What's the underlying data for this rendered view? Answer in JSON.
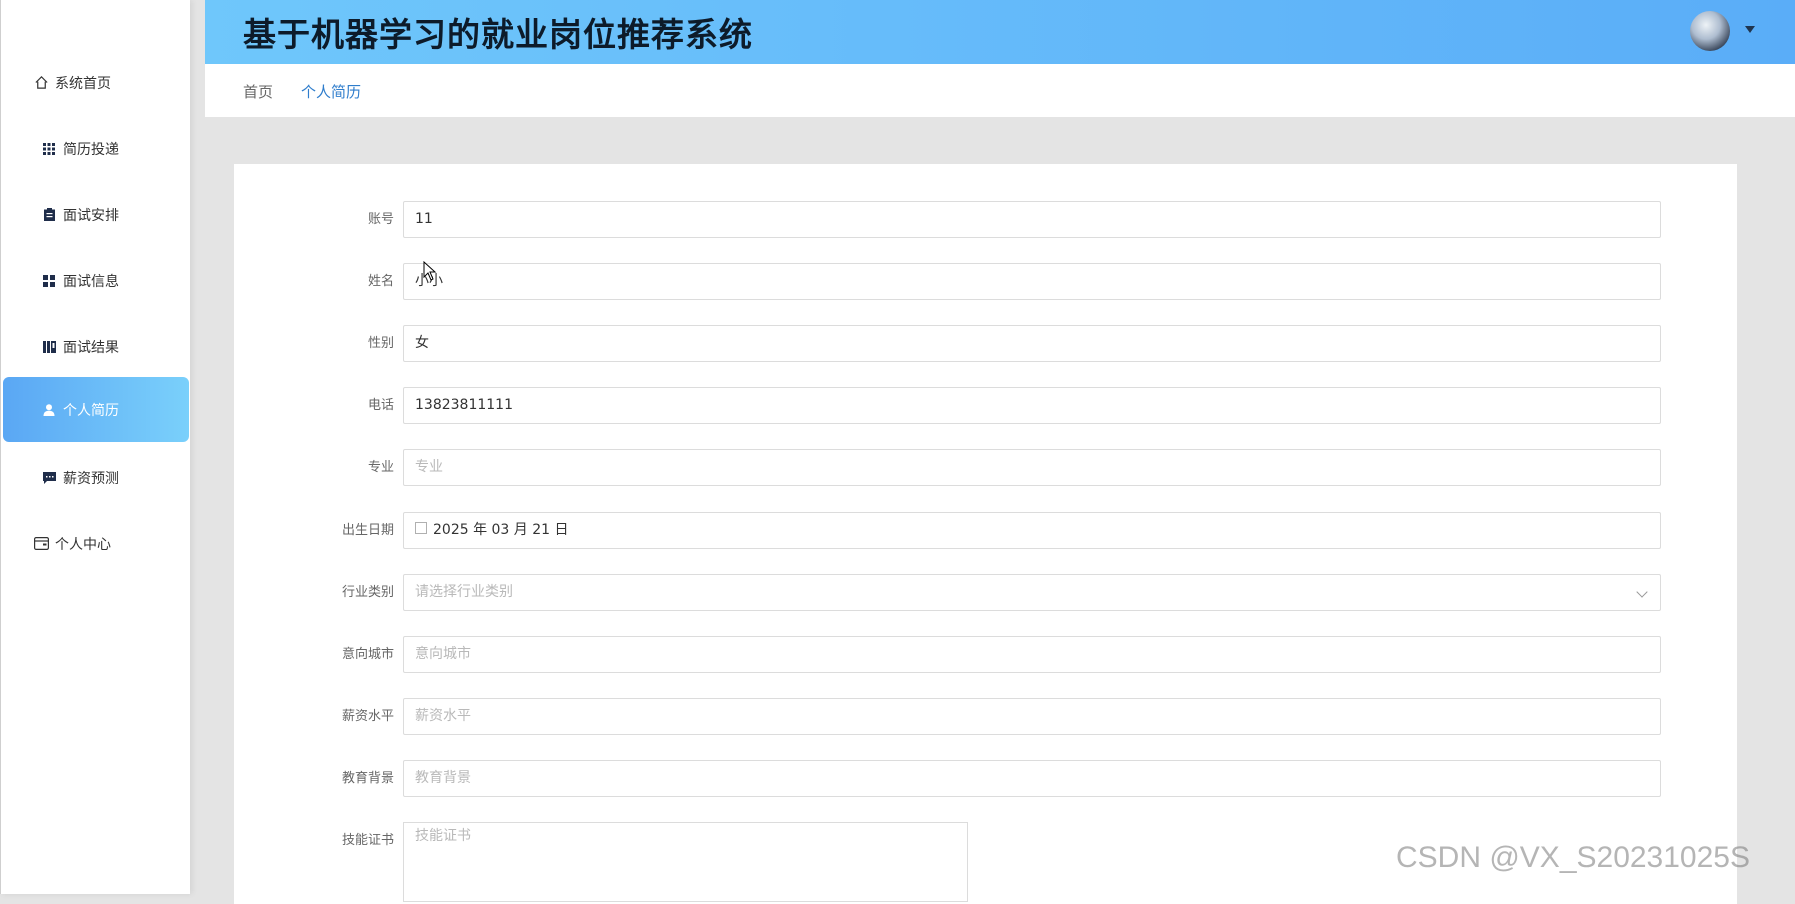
{
  "app": {
    "title": "基于机器学习的就业岗位推荐系统"
  },
  "sidebar": {
    "items": [
      {
        "label": "系统首页",
        "icon": "home-icon"
      },
      {
        "label": "简历投递",
        "icon": "grid-icon"
      },
      {
        "label": "面试安排",
        "icon": "clipboard-icon"
      },
      {
        "label": "面试信息",
        "icon": "dashboard-icon"
      },
      {
        "label": "面试结果",
        "icon": "book-icon"
      },
      {
        "label": "个人简历",
        "icon": "user-icon",
        "active": true
      },
      {
        "label": "薪资预测",
        "icon": "chat-icon"
      },
      {
        "label": "个人中心",
        "icon": "card-icon"
      }
    ]
  },
  "breadcrumb": {
    "home": "首页",
    "current": "个人简历"
  },
  "form": {
    "account": {
      "label": "账号",
      "value": "11"
    },
    "name": {
      "label": "姓名",
      "value": "小小"
    },
    "gender": {
      "label": "性别",
      "value": "女"
    },
    "phone": {
      "label": "电话",
      "value": "13823811111"
    },
    "major": {
      "label": "专业",
      "placeholder": "专业"
    },
    "birthdate": {
      "label": "出生日期",
      "value": "2025 年 03 月 21 日"
    },
    "industry": {
      "label": "行业类别",
      "placeholder": "请选择行业类别"
    },
    "city": {
      "label": "意向城市",
      "placeholder": "意向城市"
    },
    "salary": {
      "label": "薪资水平",
      "placeholder": "薪资水平"
    },
    "education": {
      "label": "教育背景",
      "placeholder": "教育背景"
    },
    "certificate": {
      "label": "技能证书",
      "placeholder": "技能证书"
    }
  },
  "watermark": "CSDN @VX_S20231025S"
}
